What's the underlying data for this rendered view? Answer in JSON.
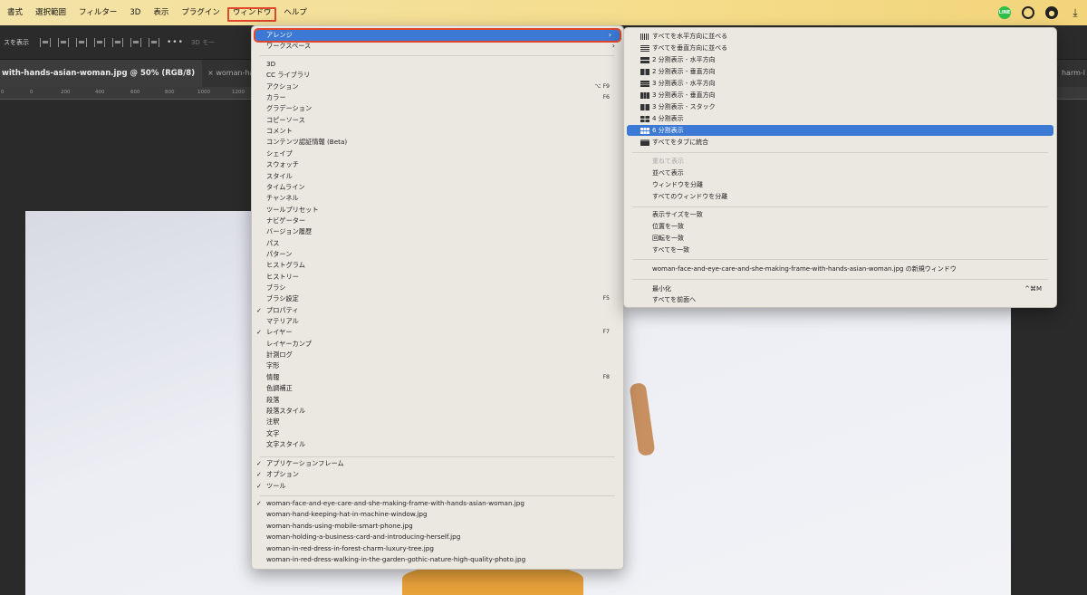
{
  "menubar": {
    "items": [
      "書式",
      "選択範囲",
      "フィルター",
      "3D",
      "表示",
      "プラグイン",
      "ウィンドウ",
      "ヘルプ"
    ],
    "active": "ウィンドウ",
    "status_icons": [
      "line-icon",
      "creative-cloud-icon",
      "user-icon",
      "download-icon"
    ],
    "line_label": "LINE"
  },
  "options_bar": {
    "show_transform": "スを表示",
    "more": "•••",
    "mode_3d": "3D モー"
  },
  "tabs": {
    "active": "with-hands-asian-woman.jpg @ 50% (RGB/8)",
    "second": "× woman-han",
    "right": "harm-l"
  },
  "ruler": [
    "0",
    "0",
    "200",
    "400",
    "600",
    "800",
    "1000",
    "1200"
  ],
  "window_menu": {
    "highlight": {
      "label": "アレンジ",
      "arrow": "›"
    },
    "workspace": {
      "label": "ワークスペース",
      "arrow": "›"
    },
    "panels": [
      {
        "label": "3D",
        "shortcut": "",
        "checked": false
      },
      {
        "label": "CC ライブラリ",
        "shortcut": "",
        "checked": false
      },
      {
        "label": "アクション",
        "shortcut": "⌥ F9",
        "checked": false
      },
      {
        "label": "カラー",
        "shortcut": "F6",
        "checked": false
      },
      {
        "label": "グラデーション",
        "shortcut": "",
        "checked": false
      },
      {
        "label": "コピーソース",
        "shortcut": "",
        "checked": false
      },
      {
        "label": "コメント",
        "shortcut": "",
        "checked": false
      },
      {
        "label": "コンテンツ認証情報 (Beta)",
        "shortcut": "",
        "checked": false
      },
      {
        "label": "シェイプ",
        "shortcut": "",
        "checked": false
      },
      {
        "label": "スウォッチ",
        "shortcut": "",
        "checked": false
      },
      {
        "label": "スタイル",
        "shortcut": "",
        "checked": false
      },
      {
        "label": "タイムライン",
        "shortcut": "",
        "checked": false
      },
      {
        "label": "チャンネル",
        "shortcut": "",
        "checked": false
      },
      {
        "label": "ツールプリセット",
        "shortcut": "",
        "checked": false
      },
      {
        "label": "ナビゲーター",
        "shortcut": "",
        "checked": false
      },
      {
        "label": "バージョン履歴",
        "shortcut": "",
        "checked": false
      },
      {
        "label": "パス",
        "shortcut": "",
        "checked": false
      },
      {
        "label": "パターン",
        "shortcut": "",
        "checked": false
      },
      {
        "label": "ヒストグラム",
        "shortcut": "",
        "checked": false
      },
      {
        "label": "ヒストリー",
        "shortcut": "",
        "checked": false
      },
      {
        "label": "ブラシ",
        "shortcut": "",
        "checked": false
      },
      {
        "label": "ブラシ設定",
        "shortcut": "F5",
        "checked": false
      },
      {
        "label": "プロパティ",
        "shortcut": "",
        "checked": true
      },
      {
        "label": "マテリアル",
        "shortcut": "",
        "checked": false
      },
      {
        "label": "レイヤー",
        "shortcut": "F7",
        "checked": true
      },
      {
        "label": "レイヤーカンプ",
        "shortcut": "",
        "checked": false
      },
      {
        "label": "計測ログ",
        "shortcut": "",
        "checked": false
      },
      {
        "label": "字形",
        "shortcut": "",
        "checked": false
      },
      {
        "label": "情報",
        "shortcut": "F8",
        "checked": false
      },
      {
        "label": "色調補正",
        "shortcut": "",
        "checked": false
      },
      {
        "label": "段落",
        "shortcut": "",
        "checked": false
      },
      {
        "label": "段落スタイル",
        "shortcut": "",
        "checked": false
      },
      {
        "label": "注釈",
        "shortcut": "",
        "checked": false
      },
      {
        "label": "文字",
        "shortcut": "",
        "checked": false
      },
      {
        "label": "文字スタイル",
        "shortcut": "",
        "checked": false
      }
    ],
    "frames": [
      {
        "label": "アプリケーションフレーム",
        "checked": true
      },
      {
        "label": "オプション",
        "checked": true
      },
      {
        "label": "ツール",
        "checked": true
      }
    ],
    "documents": [
      {
        "label": "woman-face-and-eye-care-and-she-making-frame-with-hands-asian-woman.jpg",
        "checked": true
      },
      {
        "label": "woman-hand-keeping-hat-in-machine-window.jpg",
        "checked": false
      },
      {
        "label": "woman-hands-using-mobile-smart-phone.jpg",
        "checked": false
      },
      {
        "label": "woman-holding-a-business-card-and-introducing-herself.jpg",
        "checked": false
      },
      {
        "label": "woman-in-red-dress-in-forest-charm-luxury-tree.jpg",
        "checked": false
      },
      {
        "label": "woman-in-red-dress-walking-in-the-garden-gothic-nature-high-quality-photo.jpg",
        "checked": false
      }
    ]
  },
  "arrange_menu": {
    "layouts": [
      {
        "label": "すべてを水平方向に並べる",
        "icon": "cols"
      },
      {
        "label": "すべてを垂直方向に並べる",
        "icon": "rows"
      },
      {
        "label": "2 分割表示 - 水平方向",
        "icon": "2h"
      },
      {
        "label": "2 分割表示 - 垂直方向",
        "icon": "2v"
      },
      {
        "label": "3 分割表示 - 水平方向",
        "icon": "3h"
      },
      {
        "label": "3 分割表示 - 垂直方向",
        "icon": "3v"
      },
      {
        "label": "3 分割表示 - スタック",
        "icon": "3s"
      },
      {
        "label": "4 分割表示",
        "icon": "4"
      },
      {
        "label": "6 分割表示",
        "icon": "6"
      },
      {
        "label": "すべてをタブに統合",
        "icon": "tab"
      }
    ],
    "highlighted": "6 分割表示",
    "window_ops": [
      {
        "label": "重ねて表示",
        "disabled": true
      },
      {
        "label": "並べて表示",
        "disabled": false
      },
      {
        "label": "ウィンドウを分離",
        "disabled": false
      },
      {
        "label": "すべてのウィンドウを分離",
        "disabled": false
      }
    ],
    "match_ops": [
      "表示サイズを一致",
      "位置を一致",
      "回転を一致",
      "すべてを一致"
    ],
    "new_window": "woman-face-and-eye-care-and-she-making-frame-with-hands-asian-woman.jpg の新規ウィンドウ",
    "minimize": {
      "label": "最小化",
      "shortcut": "^⌘M"
    },
    "bring_all": "すべてを前面へ"
  }
}
